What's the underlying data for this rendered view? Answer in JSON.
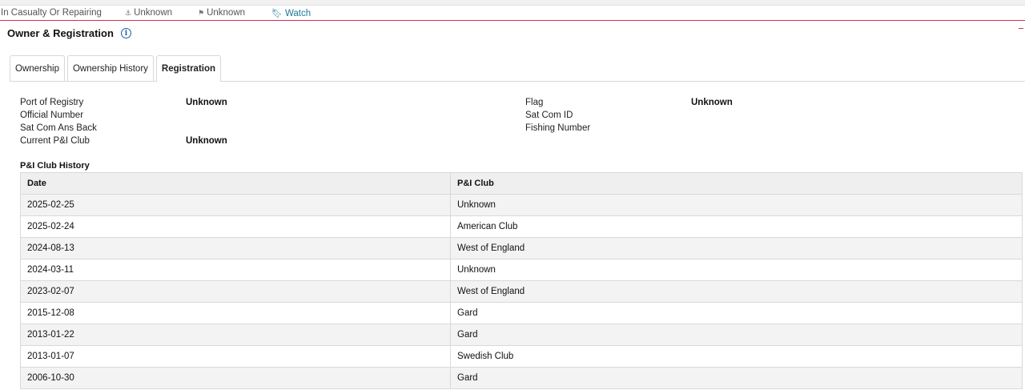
{
  "status_bar": {
    "status": "In Casualty Or Repairing",
    "anchor_text": "Unknown",
    "flag_text": "Unknown",
    "watch_label": "Watch"
  },
  "section": {
    "title": "Owner & Registration",
    "info_glyph": "i"
  },
  "tabs": [
    {
      "label": "Ownership",
      "active": false
    },
    {
      "label": "Ownership History",
      "active": false
    },
    {
      "label": "Registration",
      "active": true
    }
  ],
  "registration": {
    "left": [
      {
        "label": "Port of Registry",
        "value": "Unknown"
      },
      {
        "label": "Official Number",
        "value": ""
      },
      {
        "label": "Sat Com Ans Back",
        "value": ""
      },
      {
        "label": "Current P&I Club",
        "value": "Unknown"
      }
    ],
    "right": [
      {
        "label": "Flag",
        "value": "Unknown"
      },
      {
        "label": "Sat Com ID",
        "value": ""
      },
      {
        "label": "Fishing Number",
        "value": ""
      }
    ]
  },
  "pi_history": {
    "title": "P&I Club History",
    "columns": [
      "Date",
      "P&I Club"
    ],
    "rows": [
      [
        "2025-02-25",
        "Unknown"
      ],
      [
        "2025-02-24",
        "American Club"
      ],
      [
        "2024-08-13",
        "West of England"
      ],
      [
        "2024-03-11",
        "Unknown"
      ],
      [
        "2023-02-07",
        "West of England"
      ],
      [
        "2015-12-08",
        "Gard"
      ],
      [
        "2013-01-22",
        "Gard"
      ],
      [
        "2013-01-07",
        "Swedish Club"
      ],
      [
        "2006-10-30",
        "Gard"
      ]
    ]
  },
  "colors": {
    "accent_red": "#d62e4c",
    "watch_blue": "#1d7a9c",
    "info_blue": "#1f5fa6"
  }
}
